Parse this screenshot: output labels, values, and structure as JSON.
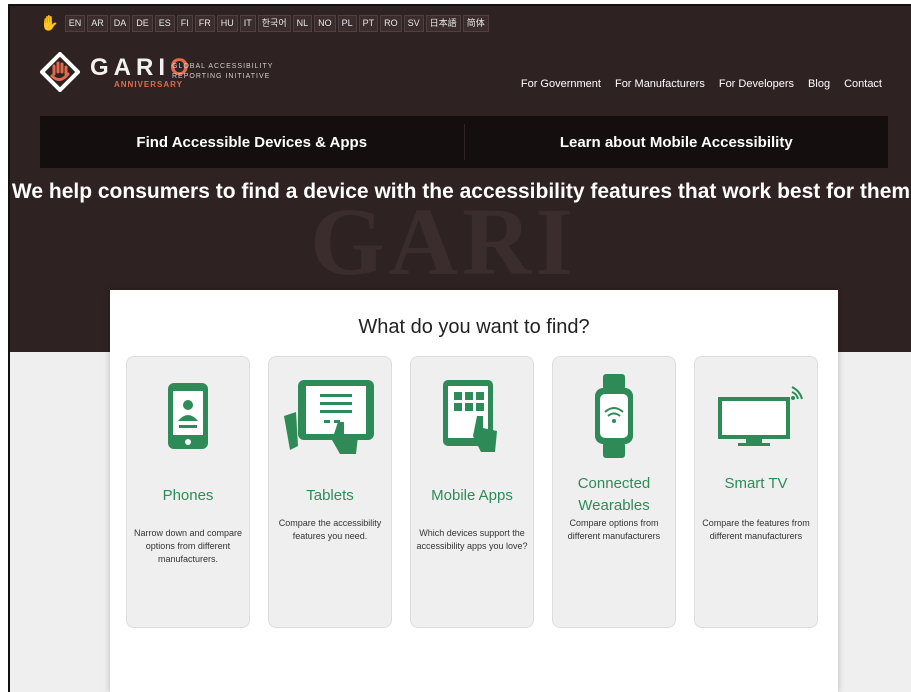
{
  "language_bar": {
    "languages": [
      "EN",
      "AR",
      "DA",
      "DE",
      "ES",
      "FI",
      "FR",
      "HU",
      "IT",
      "한국어",
      "NL",
      "NO",
      "PL",
      "PT",
      "RO",
      "SV",
      "日本語",
      "简体"
    ]
  },
  "logo": {
    "word_prefix": "GARI",
    "word_suffix": "O",
    "anniversary": "ANNIVERSARY",
    "subtitle": "GLOBAL ACCESSIBILITY REPORTING INITIATIVE"
  },
  "nav": {
    "items": [
      "For Government",
      "For Manufacturers",
      "For Developers",
      "Blog",
      "Contact"
    ]
  },
  "tabs": {
    "find_devices": "Find Accessible Devices & Apps",
    "learn_mobile": "Learn about Mobile Accessibility"
  },
  "hero": {
    "headline": "We help consumers to find a device with the accessibility features that work best for them",
    "watermark": "GARI"
  },
  "panel": {
    "title": "What do you want to find?",
    "cards": [
      {
        "title": "Phones",
        "desc": "Narrow down and compare options from different manufacturers.",
        "icon": "phone-icon"
      },
      {
        "title": "Tablets",
        "desc": "Compare the accessibility features you need.",
        "icon": "tablet-icon"
      },
      {
        "title": "Mobile Apps",
        "desc": "Which devices support the accessibility apps you love?",
        "icon": "mobile-apps-icon"
      },
      {
        "title": "Connected Wearables",
        "desc": "Compare options from different manufacturers",
        "icon": "smartwatch-icon"
      },
      {
        "title": "Smart TV",
        "desc": "Compare the features from different manufacturers",
        "icon": "smart-tv-icon"
      }
    ]
  },
  "colors": {
    "hero_bg": "#2f2223",
    "accent_green": "#2e8b57",
    "logo_orange": "#e06b4a"
  }
}
